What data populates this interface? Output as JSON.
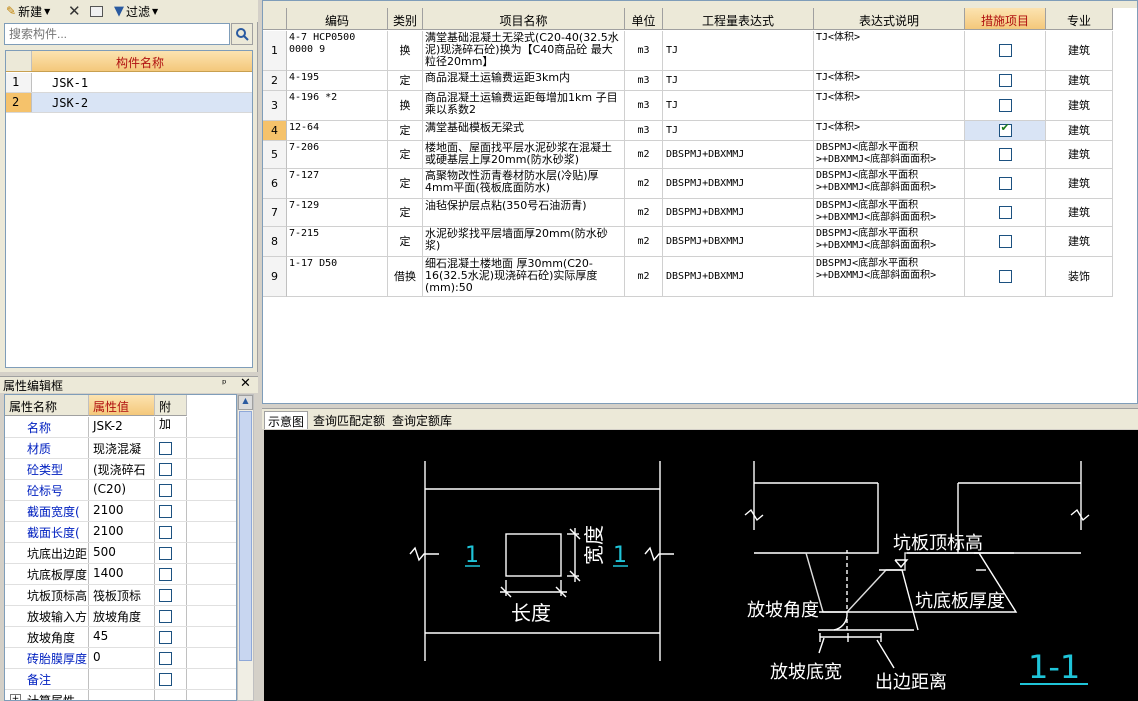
{
  "toolbar": {
    "new_label": "新建",
    "filter_label": "过滤"
  },
  "search": {
    "placeholder": "搜索构件..."
  },
  "component_list": {
    "header": "构件名称",
    "rows": [
      {
        "idx": "1",
        "name": "JSK-1"
      },
      {
        "idx": "2",
        "name": "JSK-2"
      }
    ]
  },
  "props": {
    "title": "属性编辑框",
    "pin": "ᵖ",
    "close": "✕",
    "headers": {
      "name": "属性名称",
      "value": "属性值",
      "extra": "附加"
    },
    "rows": [
      {
        "name": "名称",
        "value": "JSK-2",
        "blue": true,
        "cb": false
      },
      {
        "name": "材质",
        "value": "现浇混凝",
        "blue": true,
        "cb": true
      },
      {
        "name": "砼类型",
        "value": "(现浇碎石",
        "blue": true,
        "cb": true
      },
      {
        "name": "砼标号",
        "value": "(C20)",
        "blue": true,
        "cb": true
      },
      {
        "name": "截面宽度(",
        "value": "2100",
        "blue": true,
        "cb": true
      },
      {
        "name": "截面长度(",
        "value": "2100",
        "blue": true,
        "cb": true
      },
      {
        "name": "坑底出边距",
        "value": "500",
        "blue": false,
        "cb": true
      },
      {
        "name": "坑底板厚度",
        "value": "1400",
        "blue": false,
        "cb": true
      },
      {
        "name": "坑板顶标高",
        "value": "筏板顶标",
        "blue": false,
        "cb": true
      },
      {
        "name": "放坡输入方",
        "value": "放坡角度",
        "blue": false,
        "cb": true
      },
      {
        "name": "放坡角度",
        "value": "45",
        "blue": false,
        "cb": true
      },
      {
        "name": "砖胎膜厚度",
        "value": "0",
        "blue": true,
        "cb": true
      },
      {
        "name": "备注",
        "value": "",
        "blue": true,
        "cb": true
      },
      {
        "name": "计算属性",
        "value": "",
        "blue": false,
        "cb": false
      }
    ]
  },
  "table": {
    "headers": [
      "编码",
      "类别",
      "项目名称",
      "单位",
      "工程量表达式",
      "表达式说明",
      "措施项目",
      "专业"
    ],
    "rows": [
      {
        "n": "1",
        "code": "4-7 HCP0500 0000 9",
        "type": "换",
        "name": "满堂基础混凝土无梁式(C20-40(32.5水泥)现浇碎石砼)换为【C40商品砼 最大粒径20mm】",
        "unit": "m3",
        "expr": "TJ",
        "desc": "TJ<体积>",
        "checked": false,
        "spec": "建筑"
      },
      {
        "n": "2",
        "code": "4-195",
        "type": "定",
        "name": "商品混凝土运输费运距3km内",
        "unit": "m3",
        "expr": "TJ",
        "desc": "TJ<体积>",
        "checked": false,
        "spec": "建筑"
      },
      {
        "n": "3",
        "code": "4-196 *2",
        "type": "换",
        "name": "商品混凝土运输费运距每增加1km 子目乘以系数2",
        "unit": "m3",
        "expr": "TJ",
        "desc": "TJ<体积>",
        "checked": false,
        "spec": "建筑"
      },
      {
        "n": "4",
        "code": "12-64",
        "type": "定",
        "name": "满堂基础模板无梁式",
        "unit": "m3",
        "expr": "TJ",
        "desc": "TJ<体积>",
        "checked": true,
        "spec": "建筑"
      },
      {
        "n": "5",
        "code": "7-206",
        "type": "定",
        "name": "楼地面、屋面找平层水泥砂浆在混凝土或硬基层上厚20mm(防水砂浆)",
        "unit": "m2",
        "expr": "DBSPMJ+DBXMMJ",
        "desc": "DBSPMJ<底部水平面积>+DBXMMJ<底部斜面面积>",
        "checked": false,
        "spec": "建筑"
      },
      {
        "n": "6",
        "code": "7-127",
        "type": "定",
        "name": "高聚物改性沥青卷材防水层(冷贴)厚4mm平面(筏板底面防水)",
        "unit": "m2",
        "expr": "DBSPMJ+DBXMMJ",
        "desc": "DBSPMJ<底部水平面积>+DBXMMJ<底部斜面面积>",
        "checked": false,
        "spec": "建筑"
      },
      {
        "n": "7",
        "code": "7-129",
        "type": "定",
        "name": "油毡保护层点粘(350号石油沥青)",
        "unit": "m2",
        "expr": "DBSPMJ+DBXMMJ",
        "desc": "DBSPMJ<底部水平面积>+DBXMMJ<底部斜面面积>",
        "checked": false,
        "spec": "建筑"
      },
      {
        "n": "8",
        "code": "7-215",
        "type": "定",
        "name": "水泥砂浆找平层墙面厚20mm(防水砂浆)",
        "unit": "m2",
        "expr": "DBSPMJ+DBXMMJ",
        "desc": "DBSPMJ<底部水平面积>+DBXMMJ<底部斜面面积>",
        "checked": false,
        "spec": "建筑"
      },
      {
        "n": "9",
        "code": "1-17 D50",
        "type": "借换",
        "name": "细石混凝土楼地面 厚30mm(C20-16(32.5水泥)现浇碎石砼)实际厚度(mm):50",
        "unit": "m2",
        "expr": "DBSPMJ+DBXMMJ",
        "desc": "DBSPMJ<底部水平面积>+DBXMMJ<底部斜面面积>",
        "checked": false,
        "spec": "装饰"
      }
    ]
  },
  "tabs": [
    "示意图",
    "查询匹配定额",
    "查询定额库"
  ],
  "diagram": {
    "section_mark": "1",
    "width_label": "宽度",
    "length_label": "长度",
    "top_elev_label": "坑板顶标高",
    "slope_angle_label": "放坡角度",
    "bottom_thick_label": "坑底板厚度",
    "slope_base_label": "放坡底宽",
    "edge_dist_label": "出边距离",
    "section_title": "1-1"
  }
}
